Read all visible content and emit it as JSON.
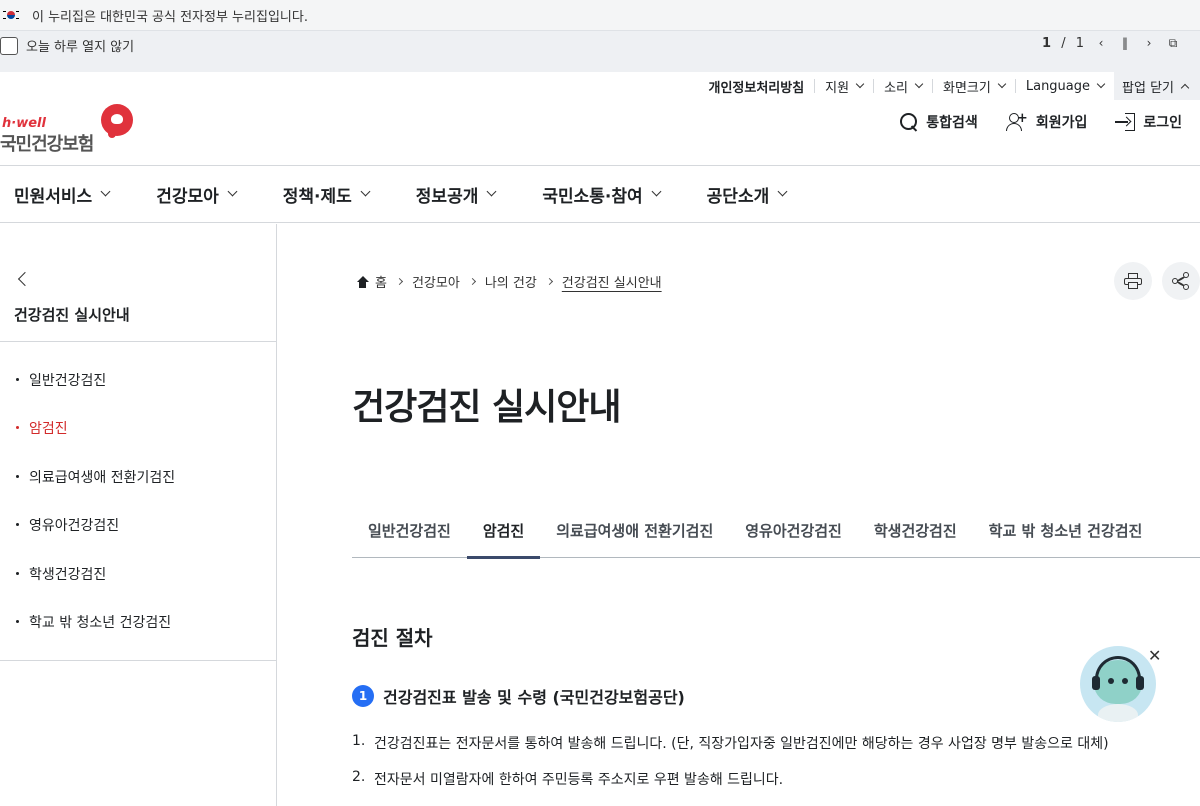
{
  "gov_banner": {
    "text": "이 누리집은 대한민국 공식 전자정부 누리집입니다."
  },
  "popup": {
    "dont_open_today": "오늘 하루 열지 않기",
    "page_current": "1",
    "page_sep": "/",
    "page_total": "1",
    "prev_icon": "chevron-left-icon",
    "pause_icon": "pause-icon",
    "next_icon": "chevron-right-icon",
    "list_icon": "window-icon"
  },
  "utility": {
    "privacy": "개인정보처리방침",
    "support": "지원",
    "sound": "소리",
    "screen_size": "화면크기",
    "language": "Language",
    "popup_close": "팝업 닫기"
  },
  "logo": {
    "en": "h·well",
    "ko": "국민건강보험"
  },
  "header": {
    "search": "통합검색",
    "signup": "회원가입",
    "login": "로그인"
  },
  "gnb": [
    "민원서비스",
    "건강모아",
    "정책·제도",
    "정보공개",
    "국민소통·참여",
    "공단소개"
  ],
  "side": {
    "title": "건강검진 실시안내",
    "items": [
      {
        "label": "일반건강검진"
      },
      {
        "label": "암검진"
      },
      {
        "label": "의료급여생애 전환기검진"
      },
      {
        "label": "영유아건강검진"
      },
      {
        "label": "학생건강검진"
      },
      {
        "label": "학교 밖 청소년 건강검진"
      }
    ]
  },
  "breadcrumb": [
    "홈",
    "건강모아",
    "나의 건강",
    "건강검진 실시안내"
  ],
  "page_title": "건강검진 실시안내",
  "tabs": [
    {
      "label": "일반건강검진"
    },
    {
      "label": "암검진"
    },
    {
      "label": "의료급여생애 전환기검진"
    },
    {
      "label": "영유아건강검진"
    },
    {
      "label": "학생건강검진"
    },
    {
      "label": "학교 밖 청소년 건강검진"
    }
  ],
  "section": {
    "title": "검진 절차",
    "step_num": "1",
    "step_title": "건강검진표 발송 및 수령 (국민건강보험공단)",
    "items": [
      {
        "n": "1.",
        "text": "건강검진표는 전자문서를 통하여 발송해 드립니다. (단, 직장가입자중 일반검진에만 해당하는 경우 사업장 명부 발송으로 대체)"
      },
      {
        "n": "2.",
        "text": "전자문서 미열람자에 한하여 주민등록 주소지로 우편 발송해 드립니다."
      }
    ]
  },
  "chatbot": {
    "close": "✕"
  },
  "colors": {
    "accent_red": "#d22a2a",
    "step_blue": "#256ef4",
    "brand_red": "#e0323c"
  }
}
